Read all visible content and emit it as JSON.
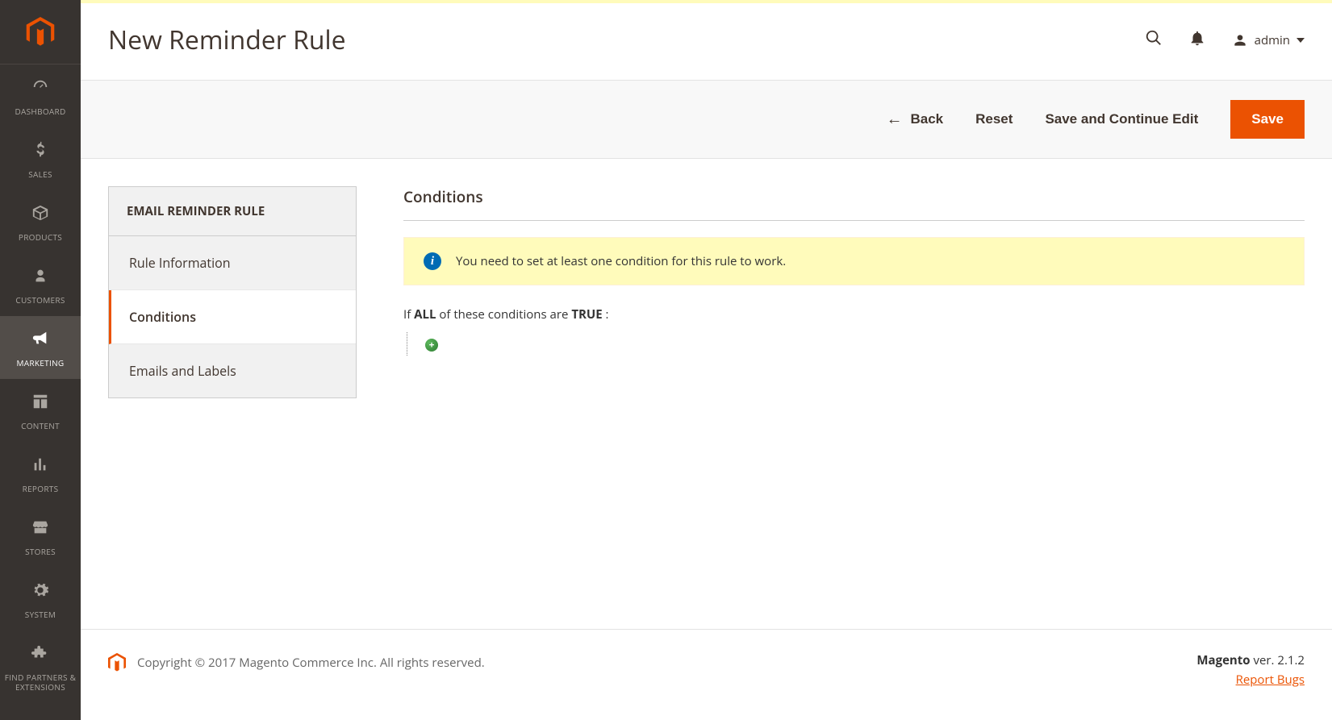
{
  "header": {
    "title": "New Reminder Rule",
    "admin_label": "admin"
  },
  "sidebar": {
    "items": [
      {
        "label": "DASHBOARD",
        "key": "dashboard"
      },
      {
        "label": "SALES",
        "key": "sales"
      },
      {
        "label": "PRODUCTS",
        "key": "products"
      },
      {
        "label": "CUSTOMERS",
        "key": "customers"
      },
      {
        "label": "MARKETING",
        "key": "marketing"
      },
      {
        "label": "CONTENT",
        "key": "content"
      },
      {
        "label": "REPORTS",
        "key": "reports"
      },
      {
        "label": "STORES",
        "key": "stores"
      },
      {
        "label": "SYSTEM",
        "key": "system"
      },
      {
        "label": "FIND PARTNERS & EXTENSIONS",
        "key": "partners"
      }
    ],
    "active": "marketing"
  },
  "actions": {
    "back": "Back",
    "reset": "Reset",
    "save_continue": "Save and Continue Edit",
    "save": "Save"
  },
  "tabs": {
    "heading": "EMAIL REMINDER RULE",
    "items": [
      {
        "label": "Rule Information"
      },
      {
        "label": "Conditions"
      },
      {
        "label": "Emails and Labels"
      }
    ],
    "active_index": 1
  },
  "conditions": {
    "section_title": "Conditions",
    "notice": "You need to set at least one condition for this rule to work.",
    "prefix": "If ",
    "aggregator": "ALL",
    "middle": " of these conditions are ",
    "value": "TRUE",
    "suffix": " :"
  },
  "footer": {
    "copyright": "Copyright © 2017 Magento Commerce Inc. All rights reserved.",
    "product": "Magento",
    "version_prefix": " ver. ",
    "version": "2.1.2",
    "report_bugs": "Report Bugs"
  }
}
